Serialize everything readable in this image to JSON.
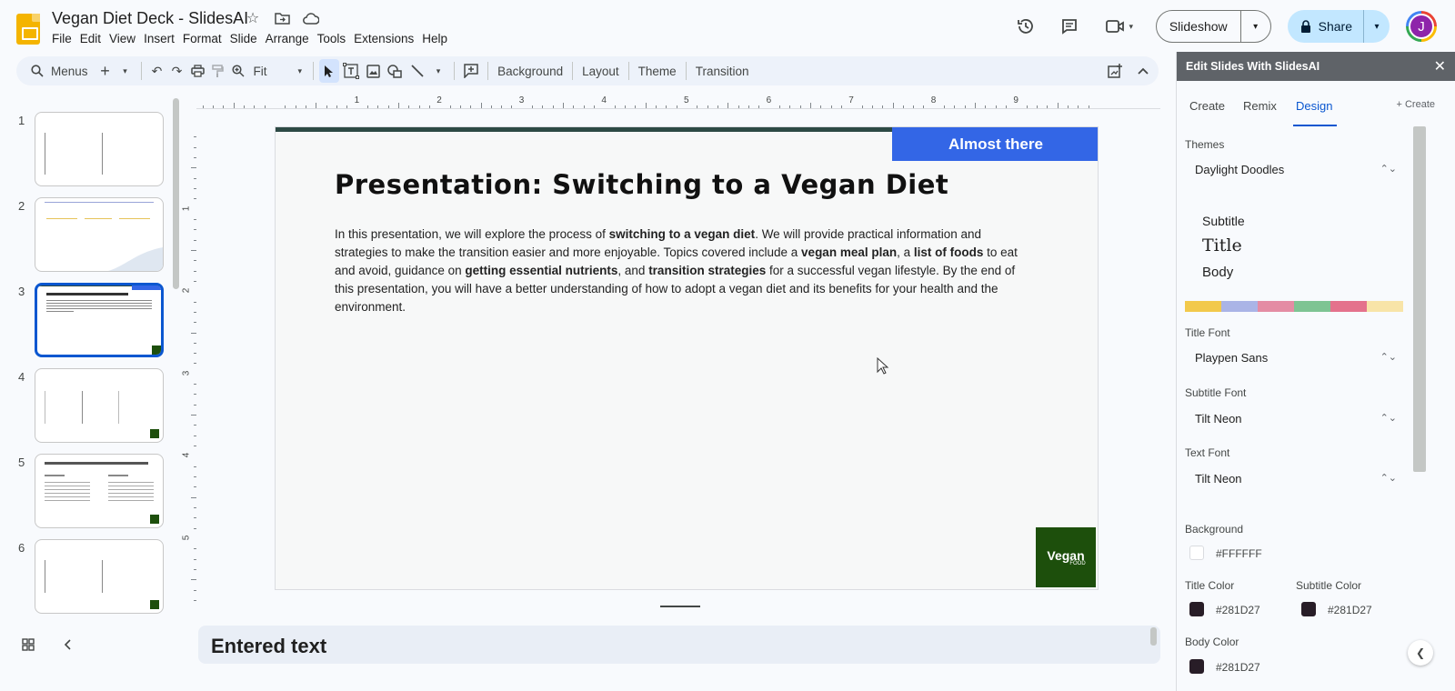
{
  "app": {
    "doc_title": "Vegan Diet Deck - SlidesAI",
    "menu": [
      "File",
      "Edit",
      "View",
      "Insert",
      "Format",
      "Slide",
      "Arrange",
      "Tools",
      "Extensions",
      "Help"
    ],
    "slideshow_label": "Slideshow",
    "share_label": "Share",
    "avatar_initial": "J"
  },
  "toolbar": {
    "search_label": "Menus",
    "zoom_label": "Fit",
    "background_label": "Background",
    "layout_label": "Layout",
    "theme_label": "Theme",
    "transition_label": "Transition"
  },
  "filmstrip": {
    "slides": [
      {
        "num": "1"
      },
      {
        "num": "2"
      },
      {
        "num": "3"
      },
      {
        "num": "4"
      },
      {
        "num": "5"
      },
      {
        "num": "6"
      }
    ],
    "active_index": 3
  },
  "rulers": {
    "top": [
      "1",
      "2",
      "3",
      "4",
      "5",
      "6",
      "7",
      "8",
      "9"
    ],
    "left": [
      "1",
      "2",
      "3",
      "4",
      "5"
    ]
  },
  "slide": {
    "badge": "Almost there",
    "title": "Presentation: Switching to a Vegan Diet",
    "body_parts": [
      {
        "t": "In this presentation, we will explore the process of ",
        "b": false
      },
      {
        "t": "switching to a vegan diet",
        "b": true
      },
      {
        "t": ". We will provide practical information and strategies to make the transition easier and more enjoyable. Topics covered include a ",
        "b": false
      },
      {
        "t": "vegan meal plan",
        "b": true
      },
      {
        "t": ", a ",
        "b": false
      },
      {
        "t": "list of foods",
        "b": true
      },
      {
        "t": " to eat and avoid, guidance on ",
        "b": false
      },
      {
        "t": "getting essential nutrients",
        "b": true
      },
      {
        "t": ", and ",
        "b": false
      },
      {
        "t": "transition strategies",
        "b": true
      },
      {
        "t": " for a successful vegan lifestyle. By the end of this presentation, you will have a better understanding of how to adopt a vegan diet and its benefits for your health and the environment.",
        "b": false
      }
    ],
    "logo_text": "Vegan",
    "logo_sub": "FOOD"
  },
  "notes": {
    "text": "Entered text"
  },
  "panel": {
    "header": "Edit Slides With SlidesAI",
    "tabs": [
      "Create",
      "Remix",
      "Design"
    ],
    "active_tab": "Design",
    "create_link": "+ Create",
    "themes_label": "Themes",
    "theme_value": "Daylight Doodles",
    "preview_subtitle": "Subtitle",
    "preview_title": "Title",
    "preview_body": "Body",
    "palette": [
      "#f2c94c",
      "#aab4e6",
      "#e48ca4",
      "#7ec493",
      "#e4728c",
      "#f8e4a8"
    ],
    "title_font_label": "Title Font",
    "title_font_value": "Playpen Sans",
    "subtitle_font_label": "Subtitle Font",
    "subtitle_font_value": "Tilt Neon",
    "text_font_label": "Text Font",
    "text_font_value": "Tilt Neon",
    "background_label": "Background",
    "background_value": "#FFFFFF",
    "title_color_label": "Title Color",
    "title_color_value": "#281D27",
    "subtitle_color_label": "Subtitle Color",
    "subtitle_color_value": "#281D27",
    "body_color_label": "Body Color",
    "body_color_value": "#281D27"
  }
}
